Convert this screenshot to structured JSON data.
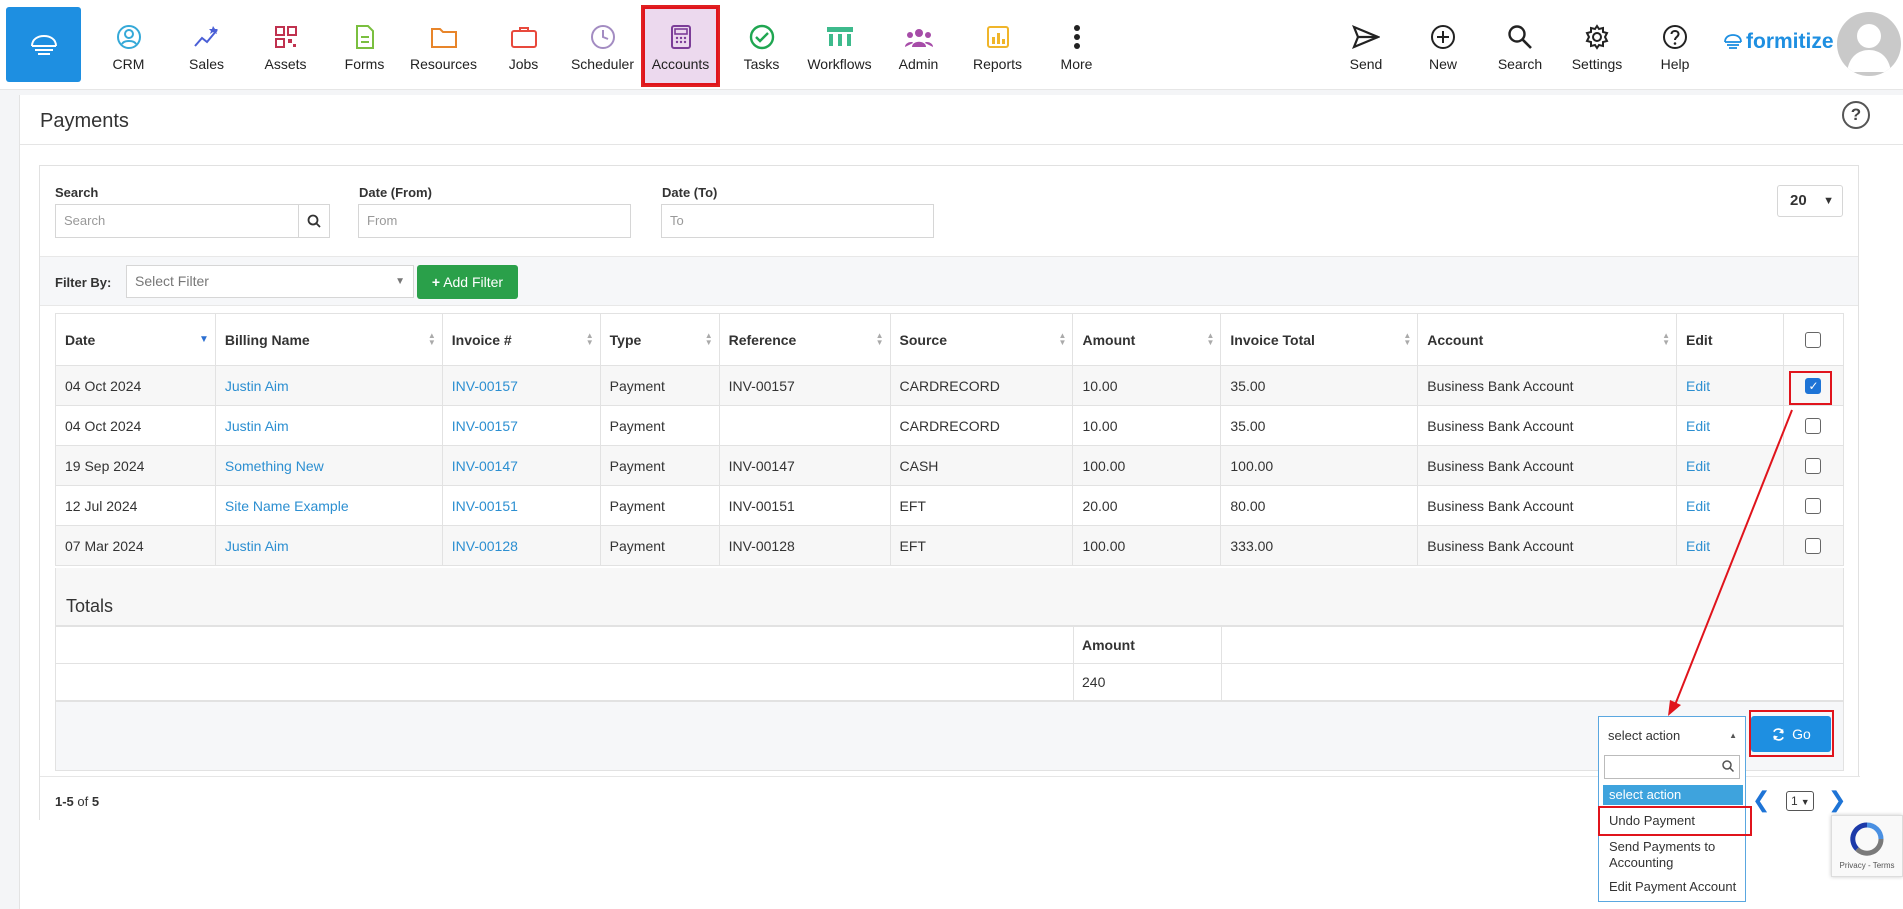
{
  "nav": {
    "items": [
      {
        "label": "CRM",
        "icon": "crm-icon"
      },
      {
        "label": "Sales",
        "icon": "sales-icon"
      },
      {
        "label": "Assets",
        "icon": "assets-icon"
      },
      {
        "label": "Forms",
        "icon": "forms-icon"
      },
      {
        "label": "Resources",
        "icon": "resources-icon"
      },
      {
        "label": "Jobs",
        "icon": "jobs-icon"
      },
      {
        "label": "Scheduler",
        "icon": "scheduler-icon"
      },
      {
        "label": "Accounts",
        "icon": "accounts-icon"
      },
      {
        "label": "Tasks",
        "icon": "tasks-icon"
      },
      {
        "label": "Workflows",
        "icon": "workflows-icon"
      },
      {
        "label": "Admin",
        "icon": "admin-icon"
      },
      {
        "label": "Reports",
        "icon": "reports-icon"
      },
      {
        "label": "More",
        "icon": "more-icon"
      }
    ],
    "right": [
      {
        "label": "Send",
        "icon": "send-icon"
      },
      {
        "label": "New",
        "icon": "new-icon"
      },
      {
        "label": "Search",
        "icon": "search-icon"
      },
      {
        "label": "Settings",
        "icon": "settings-icon"
      },
      {
        "label": "Help",
        "icon": "help-icon"
      }
    ],
    "brand": "formitize",
    "active": "Accounts",
    "accent": "#1e8fe1"
  },
  "page": {
    "title": "Payments",
    "help": "?"
  },
  "filters": {
    "search_label": "Search",
    "search_placeholder": "Search",
    "date_from_label": "Date (From)",
    "date_from_placeholder": "From",
    "date_to_label": "Date (To)",
    "date_to_placeholder": "To",
    "page_size": "20",
    "filter_by_label": "Filter By:",
    "select_filter": "Select Filter",
    "add_filter": "Add Filter"
  },
  "table": {
    "columns": [
      "Date",
      "Billing Name",
      "Invoice #",
      "Type",
      "Reference",
      "Source",
      "Amount",
      "Invoice Total",
      "Account",
      "Edit"
    ],
    "rows": [
      {
        "date": "04 Oct 2024",
        "billing": "Justin Aim",
        "invoice": "INV-00157",
        "type": "Payment",
        "reference": "INV-00157",
        "source": "CARDRECORD",
        "amount": "10.00",
        "total": "35.00",
        "account": "Business Bank Account",
        "edit": "Edit",
        "checked": true
      },
      {
        "date": "04 Oct 2024",
        "billing": "Justin Aim",
        "invoice": "INV-00157",
        "type": "Payment",
        "reference": "",
        "source": "CARDRECORD",
        "amount": "10.00",
        "total": "35.00",
        "account": "Business Bank Account",
        "edit": "Edit",
        "checked": false
      },
      {
        "date": "19 Sep 2024",
        "billing": "Something New",
        "invoice": "INV-00147",
        "type": "Payment",
        "reference": "INV-00147",
        "source": "CASH",
        "amount": "100.00",
        "total": "100.00",
        "account": "Business Bank Account",
        "edit": "Edit",
        "checked": false
      },
      {
        "date": "12 Jul 2024",
        "billing": "Site Name Example",
        "invoice": "INV-00151",
        "type": "Payment",
        "reference": "INV-00151",
        "source": "EFT",
        "amount": "20.00",
        "total": "80.00",
        "account": "Business Bank Account",
        "edit": "Edit",
        "checked": false
      },
      {
        "date": "07 Mar 2024",
        "billing": "Justin Aim",
        "invoice": "INV-00128",
        "type": "Payment",
        "reference": "INV-00128",
        "source": "EFT",
        "amount": "100.00",
        "total": "333.00",
        "account": "Business Bank Account",
        "edit": "Edit",
        "checked": false
      }
    ]
  },
  "totals": {
    "label": "Totals",
    "amount_header": "Amount",
    "amount_value": "240"
  },
  "actions": {
    "selected": "select action",
    "options": [
      "select action",
      "Undo Payment",
      "Send Payments to Accounting",
      "Edit Payment Account"
    ],
    "go": "Go"
  },
  "footer": {
    "range": "1-5",
    "of": "of",
    "total": "5",
    "page": "1"
  },
  "recaptcha": {
    "privacy": "Privacy",
    "sep": " - ",
    "terms": "Terms"
  }
}
